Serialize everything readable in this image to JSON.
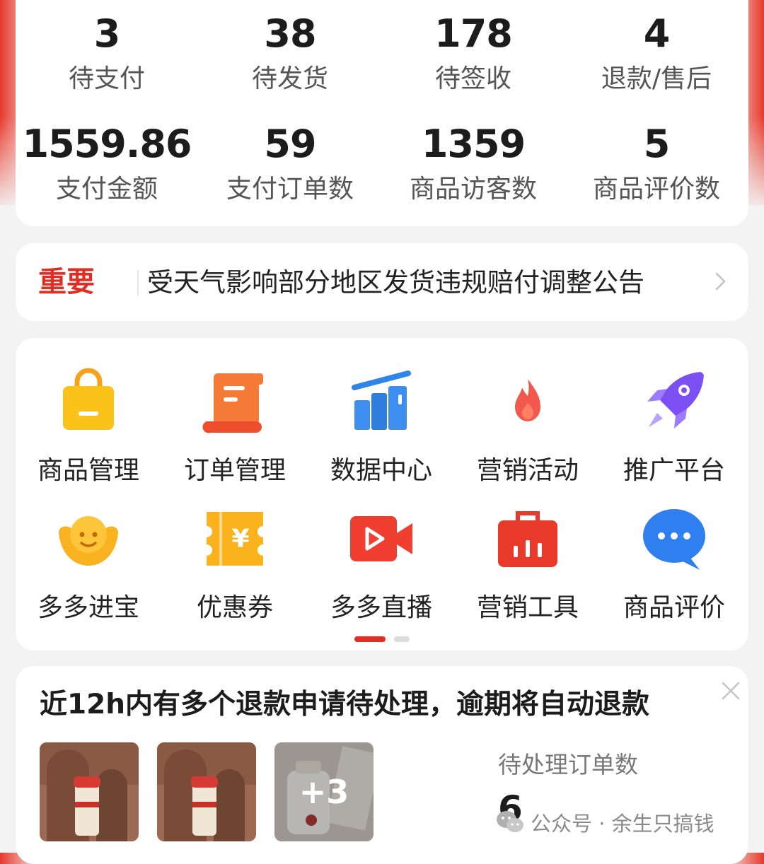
{
  "stats": [
    {
      "value": "3",
      "label": "待支付"
    },
    {
      "value": "38",
      "label": "待发货"
    },
    {
      "value": "178",
      "label": "待签收"
    },
    {
      "value": "4",
      "label": "退款/售后"
    },
    {
      "value": "1559.86",
      "label": "支付金额"
    },
    {
      "value": "59",
      "label": "支付订单数"
    },
    {
      "value": "1359",
      "label": "商品访客数"
    },
    {
      "value": "5",
      "label": "商品评价数"
    }
  ],
  "notice": {
    "tag": "重要",
    "text": "受天气影响部分地区发货违规赔付调整公告"
  },
  "grid": [
    {
      "label": "商品管理",
      "icon": "shopping-bag-icon"
    },
    {
      "label": "订单管理",
      "icon": "order-scroll-icon"
    },
    {
      "label": "数据中心",
      "icon": "bar-chart-icon"
    },
    {
      "label": "营销活动",
      "icon": "flame-icon"
    },
    {
      "label": "推广平台",
      "icon": "rocket-icon"
    },
    {
      "label": "多多进宝",
      "icon": "gold-ingot-icon"
    },
    {
      "label": "优惠券",
      "icon": "coupon-icon"
    },
    {
      "label": "多多直播",
      "icon": "video-camera-icon"
    },
    {
      "label": "营销工具",
      "icon": "toolbox-icon"
    },
    {
      "label": "商品评价",
      "icon": "chat-bubble-icon"
    }
  ],
  "pager": {
    "current": 1,
    "total": 2
  },
  "refund": {
    "title": "近12h内有多个退款申请待处理，逾期将自动退款",
    "thumbs": [
      {
        "overlay": ""
      },
      {
        "overlay": ""
      },
      {
        "overlay": "+3"
      }
    ],
    "pending_label": "待处理订单数",
    "pending_value": "6"
  },
  "watermark": {
    "text": "公众号 · 余生只搞钱",
    "icon": "wechat-icon"
  },
  "colors": {
    "accent": "#e02e24",
    "background": "#f3f3f3"
  }
}
